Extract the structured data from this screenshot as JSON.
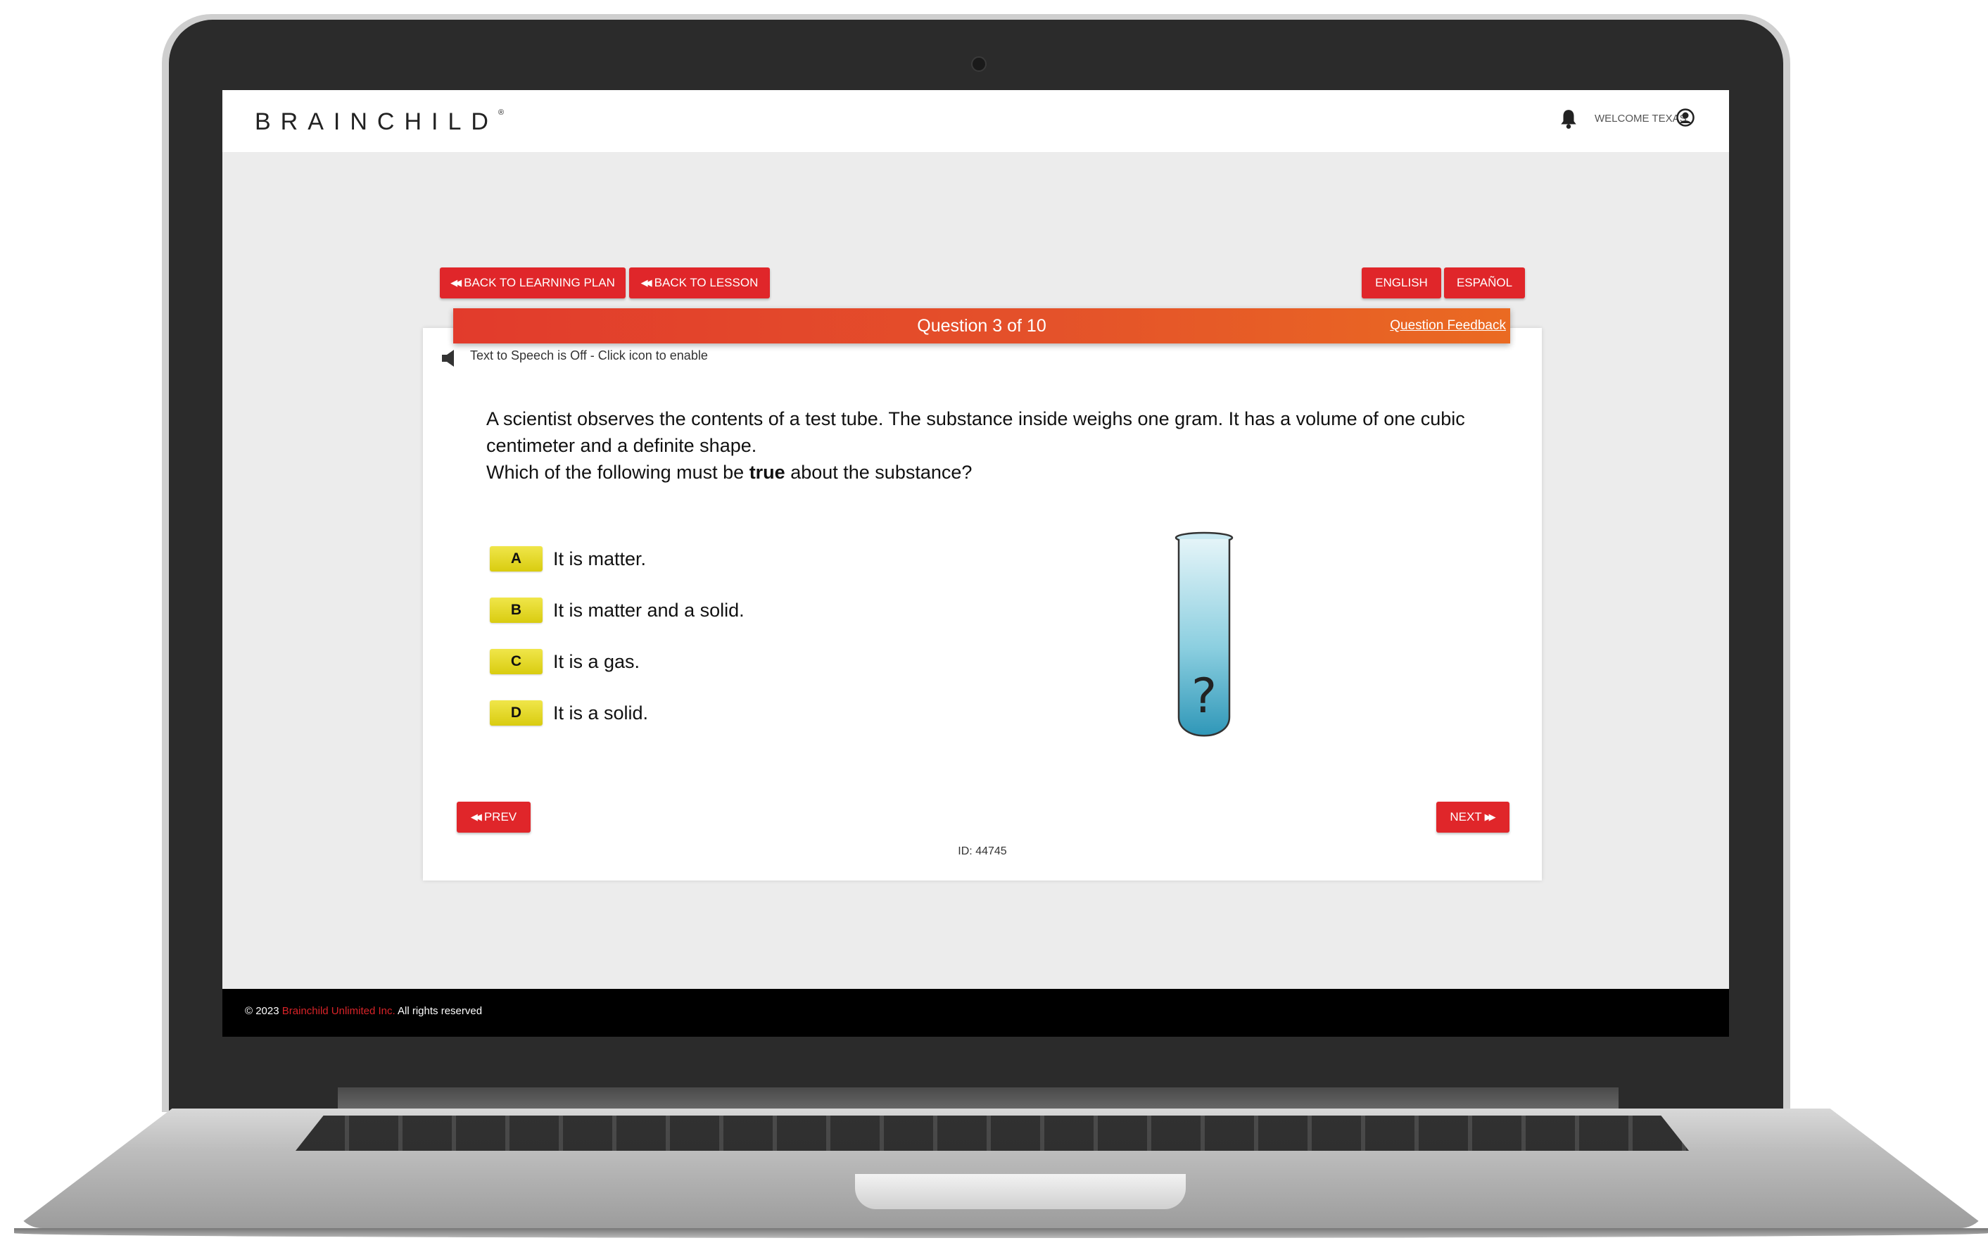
{
  "header": {
    "logo": "BRAINCHILD",
    "welcome": "WELCOME TEXAS"
  },
  "nav": {
    "back_to_learning_plan": "BACK TO LEARNING PLAN",
    "back_to_lesson": "BACK TO LESSON",
    "english": "ENGLISH",
    "espanol": "ESPAÑOL"
  },
  "question_header": {
    "title": "Question 3 of 10",
    "feedback": "Question Feedback"
  },
  "tts": {
    "status": "Text to Speech is Off - Click icon to enable"
  },
  "question": {
    "line1": "A scientist observes the contents of a test tube. The substance inside weighs one gram. It has a volume of one cubic centimeter and a definite shape.",
    "line2_before": "Which of the following must be ",
    "line2_bold": "true",
    "line2_after": " about the substance?"
  },
  "choices": [
    {
      "letter": "A",
      "text": "It is matter."
    },
    {
      "letter": "B",
      "text": "It is matter and a solid."
    },
    {
      "letter": "C",
      "text": "It is a gas."
    },
    {
      "letter": "D",
      "text": "It is a solid."
    }
  ],
  "image": {
    "tube_symbol": "?"
  },
  "pagination": {
    "prev": "PREV",
    "next": "NEXT"
  },
  "id_label": "ID: 44745",
  "footer": {
    "copyright": "© 2023",
    "brand": "Brainchild Unlimited Inc.",
    "rights": "All rights reserved"
  },
  "colors": {
    "accent_red": "#e0262a",
    "header_gradient_start": "#e23b2c",
    "header_gradient_end": "#ea6a22",
    "choice_yellow": "#e6dc22",
    "tube_blue": "#4fb0cc"
  }
}
